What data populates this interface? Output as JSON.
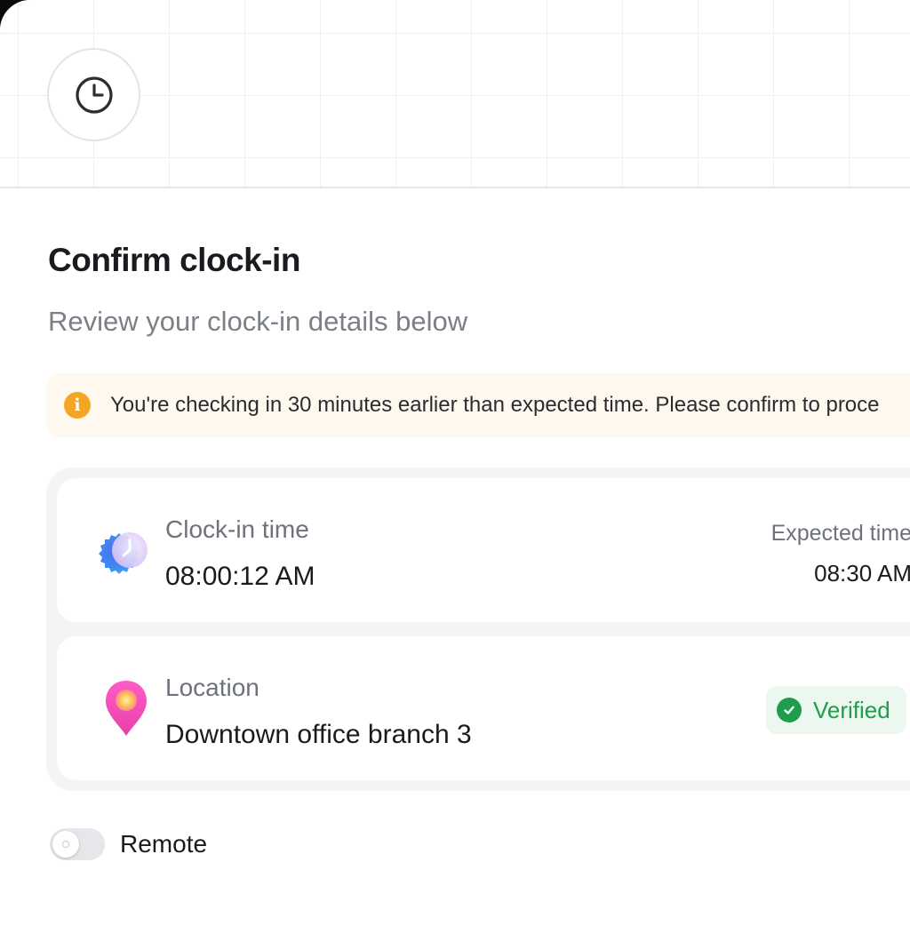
{
  "header": {
    "icon": "clock-icon"
  },
  "title": "Confirm clock-in",
  "subtitle": "Review your clock-in details below",
  "alert": {
    "icon": "info-icon",
    "icon_glyph": "i",
    "text": "You're checking in 30 minutes earlier than expected time. Please confirm to proce",
    "color": "#f5a524"
  },
  "clock_in": {
    "icon": "clock-badge-icon",
    "label": "Clock-in time",
    "value": "08:00:12 AM",
    "expected_label": "Expected time",
    "expected_value": "08:30 AM"
  },
  "location": {
    "icon": "location-pin-icon",
    "label": "Location",
    "value": "Downtown office branch 3",
    "status": "Verified",
    "status_color": "#1f9d4c"
  },
  "remote_toggle": {
    "label": "Remote",
    "on": false
  }
}
